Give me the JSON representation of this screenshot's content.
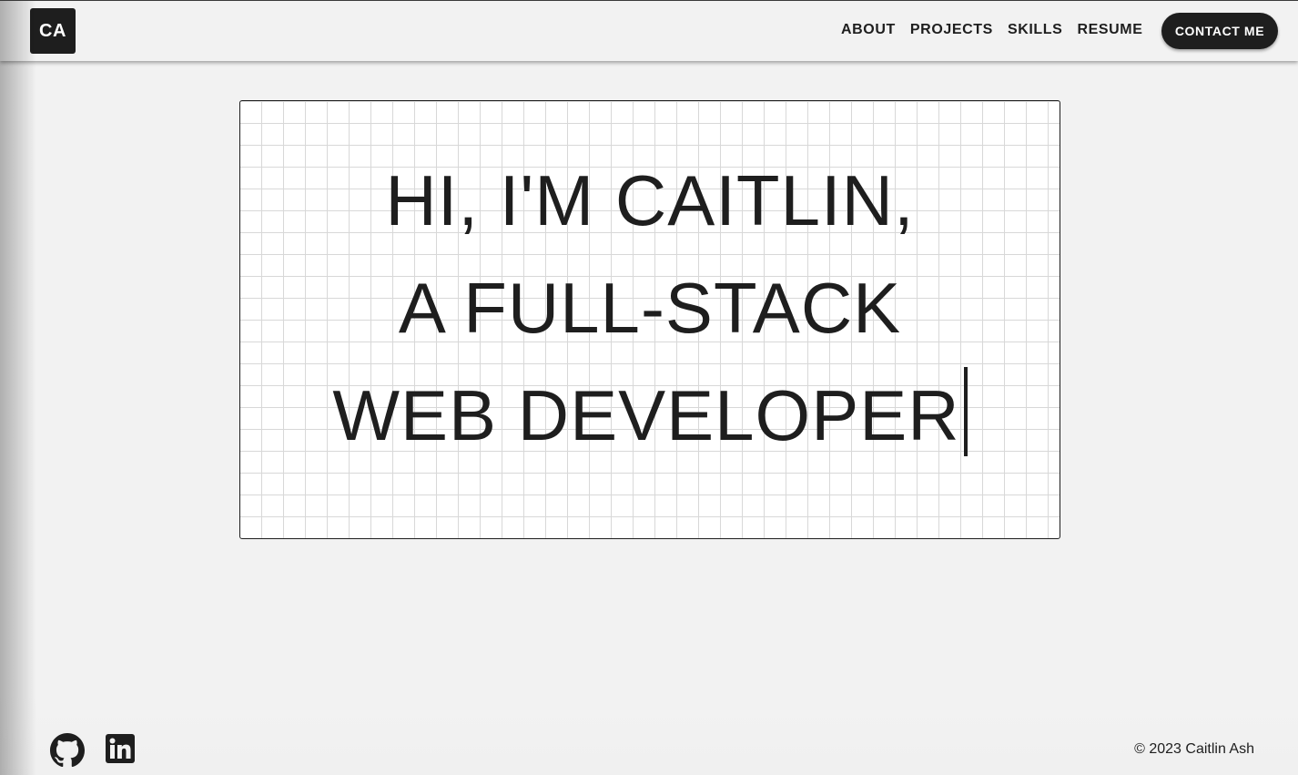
{
  "header": {
    "logo_text": "CA",
    "nav": [
      {
        "label": "ABOUT"
      },
      {
        "label": "PROJECTS"
      },
      {
        "label": "SKILLS"
      },
      {
        "label": "RESUME"
      }
    ],
    "contact_button": "CONTACT ME"
  },
  "hero": {
    "lines": [
      "HI, I'M CAITLIN,",
      "A FULL-STACK",
      "WEB DEVELOPER"
    ]
  },
  "footer": {
    "icons": [
      "github-icon",
      "linkedin-icon"
    ],
    "copyright": "© 2023 Caitlin Ash"
  },
  "colors": {
    "background": "#f2f2f2",
    "text": "#1e1e1e",
    "grid": "#d8d8d8",
    "card": "#ffffff"
  }
}
